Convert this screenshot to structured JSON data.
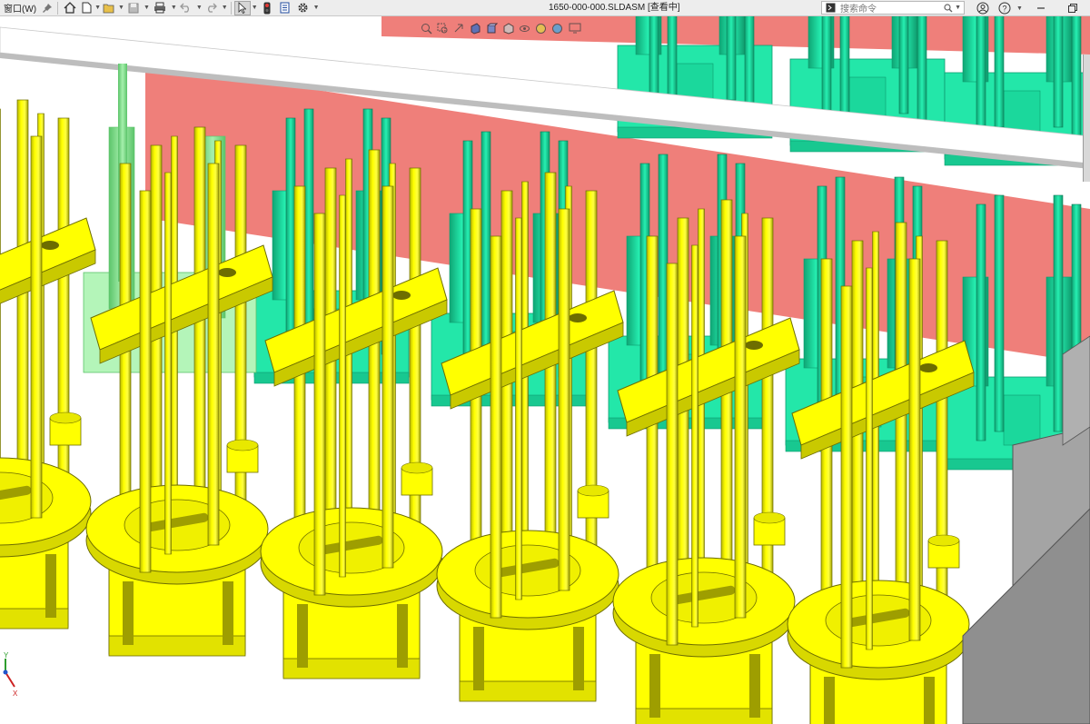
{
  "toolbar": {
    "window_menu": "窗口(W)",
    "document_title": "1650-000-000.SLDASM [查看中]",
    "search_placeholder": "搜索命令"
  },
  "icons": [
    "pin-icon",
    "home-icon",
    "new-document-icon",
    "open-icon",
    "save-icon",
    "print-icon",
    "undo-icon",
    "redo-icon",
    "select-arrow-icon",
    "traffic-light-icon",
    "file-properties-icon",
    "gear-icon",
    "command-prompt-icon",
    "search-icon",
    "user-icon",
    "help-icon",
    "minimize-icon"
  ],
  "colors": {
    "part_yellow": "#ffff00",
    "part_green": "#22e6a8",
    "frame_red": "#ef7f7a",
    "part_gray": "#8f8f8f",
    "light_green": "#8ee89a"
  },
  "triad": {
    "x_label": "X",
    "y_label": "Y"
  }
}
